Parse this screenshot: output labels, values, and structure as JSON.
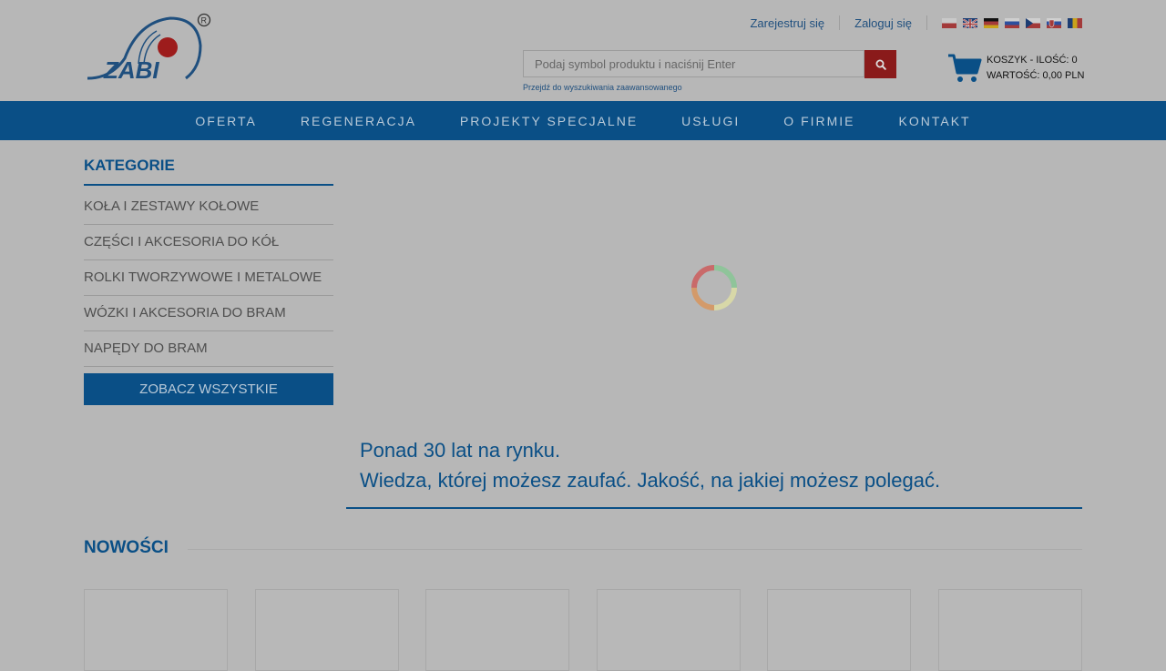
{
  "header": {
    "logo_text": "ZABI",
    "register_label": "Zarejestruj się",
    "login_label": "Zaloguj się",
    "flags": [
      "pl",
      "gb",
      "de",
      "ru",
      "cz",
      "sk",
      "ro"
    ]
  },
  "search": {
    "placeholder": "Podaj symbol produktu i naciśnij Enter",
    "value": "",
    "advanced_link": "Przejdź do wyszukiwania zaawansowanego",
    "button_icon": "search-icon"
  },
  "cart": {
    "line1": "KOSZYK - ILOŚĆ: 0",
    "line2": "WARTOŚĆ: 0,00 PLN"
  },
  "nav": {
    "items": [
      "OFERTA",
      "REGENERACJA",
      "PROJEKTY SPECJALNE",
      "USŁUGI",
      "O FIRMIE",
      "KONTAKT"
    ]
  },
  "sidebar": {
    "title": "KATEGORIE",
    "items": [
      "KOŁA I ZESTAWY KOŁOWE",
      "CZĘŚCI I AKCESORIA DO KÓŁ",
      "ROLKI TWORZYWOWE I METALOWE",
      "WÓZKI I AKCESORIA DO BRAM",
      "NAPĘDY DO BRAM"
    ],
    "all_button": "ZOBACZ WSZYSTKIE"
  },
  "tagline": {
    "line1": "Ponad 30 lat na rynku.",
    "line2": "Wiedza, której możesz zaufać. Jakość, na jakiej możesz polegać."
  },
  "news": {
    "title": "NOWOŚCI",
    "product_count": 6
  },
  "colors": {
    "brand_blue": "#0a4f86",
    "overlay": "#b7b7b7",
    "accent_red": "#8a1a1a"
  }
}
